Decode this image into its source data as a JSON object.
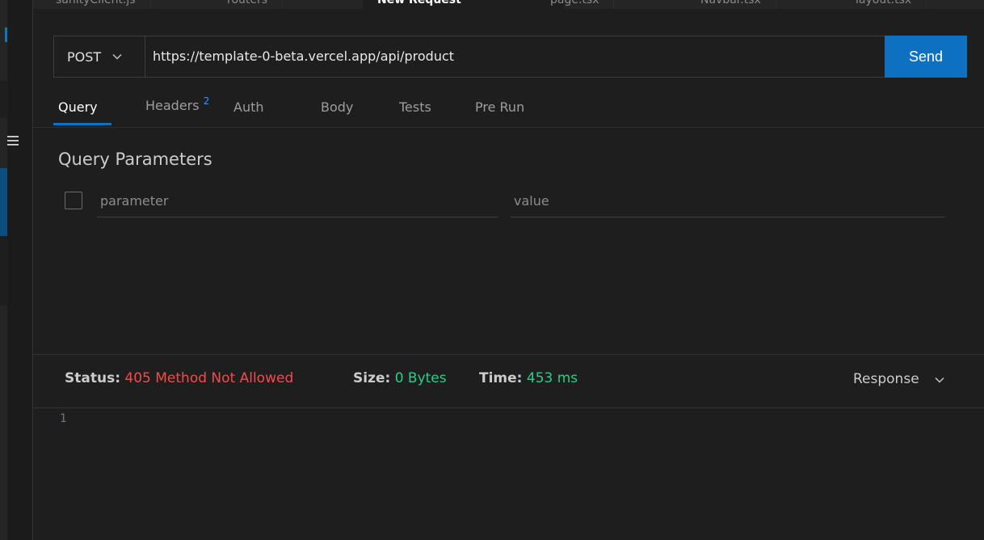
{
  "tabs": [
    {
      "label": "sanityClient.js",
      "active": false
    },
    {
      "label": "routers",
      "active": false
    },
    {
      "label": "New Request",
      "active": true
    },
    {
      "label": "page.tsx",
      "active": false
    },
    {
      "label": "Navbar.tsx",
      "active": false
    },
    {
      "label": "layout.tsx",
      "active": false
    }
  ],
  "request": {
    "method": "POST",
    "url": "https://template-0-beta.vercel.app/api/product",
    "send_label": "Send"
  },
  "subtabs": {
    "query": "Query",
    "headers": "Headers",
    "headers_count": "2",
    "auth": "Auth",
    "body": "Body",
    "tests": "Tests",
    "prerun": "Pre Run"
  },
  "query_params": {
    "title": "Query Parameters",
    "param_placeholder": "parameter",
    "value_placeholder": "value"
  },
  "response": {
    "status_label": "Status:",
    "status_value": "405 Method Not Allowed",
    "size_label": "Size:",
    "size_value": "0 Bytes",
    "time_label": "Time:",
    "time_value": "453 ms",
    "view_select": "Response",
    "line_number": "1"
  },
  "colors": {
    "accent": "#0e70c0",
    "error": "#f14c4c",
    "success": "#23d18b"
  }
}
